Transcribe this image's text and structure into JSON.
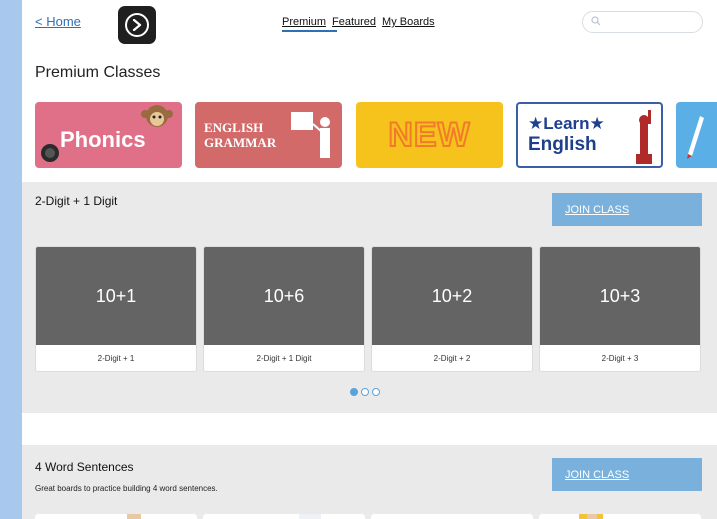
{
  "header": {
    "home_link": "< Home",
    "nav": [
      "Premium",
      "Featured",
      "My Boards"
    ],
    "search_placeholder": ""
  },
  "page_title": "Premium Classes",
  "banners": [
    {
      "name": "phonics",
      "text": "Phonics",
      "color": "#e07087"
    },
    {
      "name": "english-grammar",
      "line1": "ENGLISH",
      "line2": "GRAMMAR",
      "color": "#d36a6a"
    },
    {
      "name": "new",
      "text": "NEW",
      "color": "#f6c21c"
    },
    {
      "name": "learn-english",
      "line1": "★Learn★",
      "line2": "English",
      "color": "#1e3f8c"
    }
  ],
  "classes": [
    {
      "title": "2-Digit + 1 Digit",
      "join_label": "JOIN CLASS",
      "cards": [
        {
          "thumb": "10+1",
          "label": "2-Digit + 1"
        },
        {
          "thumb": "10+6",
          "label": "2-Digit + 1 Digit"
        },
        {
          "thumb": "10+2",
          "label": "2-Digit + 2"
        },
        {
          "thumb": "10+3",
          "label": "2-Digit + 3"
        }
      ]
    },
    {
      "title": "4 Word Sentences",
      "description": "Great boards to practice building 4 word sentences.",
      "join_label": "JOIN CLASS"
    }
  ],
  "colors": {
    "accent": "#2f6fb3",
    "join_button": "#79b1dc",
    "card_thumb": "#646464"
  }
}
